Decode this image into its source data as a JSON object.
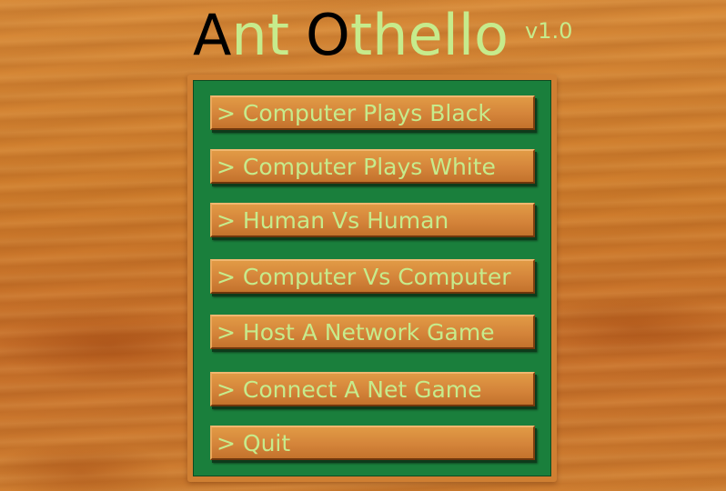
{
  "title": {
    "letter1": "A",
    "rest1": "nt",
    "letter2": "O",
    "rest2": "thello",
    "version": "v1.0"
  },
  "menu": {
    "items": [
      {
        "label": "> Computer Plays Black"
      },
      {
        "label": "> Computer Plays White"
      },
      {
        "label": "> Human Vs Human"
      },
      {
        "label": "> Computer Vs Computer"
      },
      {
        "label": "> Host A Network Game"
      },
      {
        "label": "> Connect A Net Game"
      },
      {
        "label": "> Quit"
      }
    ]
  },
  "colors": {
    "title_green": "#c6eb8c",
    "title_cap": "#000000",
    "panel_green": "#1a7f3c",
    "wood": "#cf7d2c"
  }
}
